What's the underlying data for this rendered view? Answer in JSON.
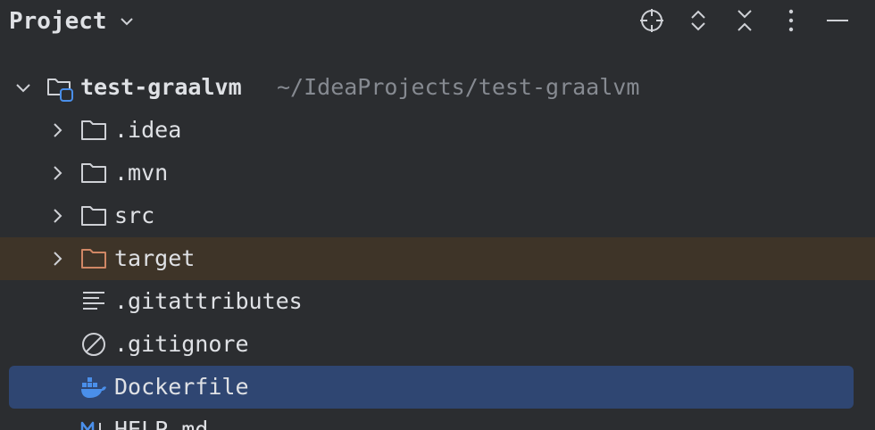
{
  "panel": {
    "title": "Project",
    "buttons": [
      {
        "name": "locate",
        "icon": "crosshair-icon"
      },
      {
        "name": "expand-all",
        "icon": "expand-icon"
      },
      {
        "name": "collapse-all",
        "icon": "collapse-icon"
      },
      {
        "name": "options",
        "icon": "more-vertical-icon"
      },
      {
        "name": "hide",
        "icon": "minimize-icon"
      }
    ]
  },
  "tree": {
    "root": {
      "label": "test-graalvm",
      "path": "~/IdeaProjects/test-graalvm",
      "icon": "project-folder-icon",
      "expanded": true
    },
    "items": [
      {
        "label": ".idea",
        "icon": "folder-icon",
        "expandable": true
      },
      {
        "label": ".mvn",
        "icon": "folder-icon",
        "expandable": true
      },
      {
        "label": "src",
        "icon": "folder-icon",
        "expandable": true
      },
      {
        "label": "target",
        "icon": "excluded-folder-icon",
        "expandable": true,
        "highlighted": true
      },
      {
        "label": ".gitattributes",
        "icon": "text-file-icon",
        "expandable": false
      },
      {
        "label": ".gitignore",
        "icon": "ignore-file-icon",
        "expandable": false
      },
      {
        "label": "Dockerfile",
        "icon": "docker-icon",
        "expandable": false,
        "selected": true
      },
      {
        "label": "HELP.md",
        "icon": "markdown-icon",
        "expandable": false
      }
    ]
  },
  "colors": {
    "background": "#2b2d30",
    "selection": "#2f4672",
    "excluded_highlight": "#3e3428",
    "excluded_folder": "#d08765",
    "docker_blue": "#4a8fea",
    "path_gray": "#868a91",
    "text": "#dfe1e5"
  }
}
